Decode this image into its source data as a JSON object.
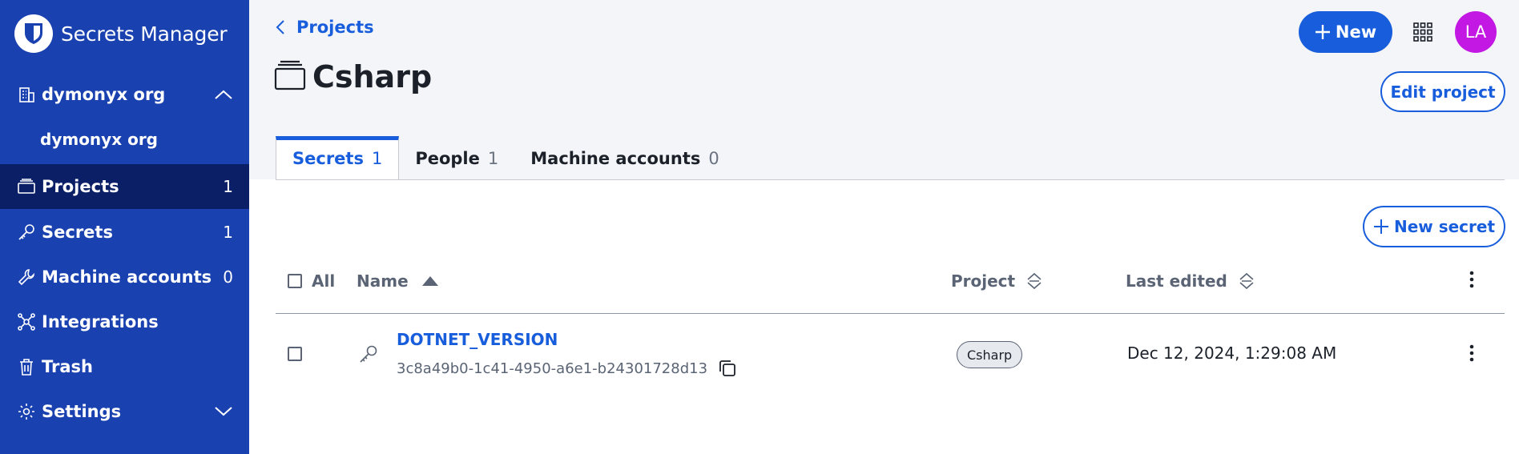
{
  "app": {
    "title": "Secrets Manager"
  },
  "sidebar": {
    "org": {
      "label": "dymonyx org",
      "sub_label": "dymonyx org"
    },
    "items": [
      {
        "label": "Projects",
        "count": "1",
        "icon": "project-icon"
      },
      {
        "label": "Secrets",
        "count": "1",
        "icon": "key-icon"
      },
      {
        "label": "Machine accounts",
        "count": "0",
        "icon": "wrench-icon"
      },
      {
        "label": "Integrations",
        "count": "",
        "icon": "integrations-icon"
      },
      {
        "label": "Trash",
        "count": "",
        "icon": "trash-icon"
      },
      {
        "label": "Settings",
        "count": "",
        "icon": "gear-icon"
      }
    ]
  },
  "header": {
    "breadcrumb": "Projects",
    "page_title": "Csharp",
    "new_label": "New",
    "avatar_initials": "LA",
    "edit_project_label": "Edit project"
  },
  "tabs": [
    {
      "label": "Secrets",
      "count": "1"
    },
    {
      "label": "People",
      "count": "1"
    },
    {
      "label": "Machine accounts",
      "count": "0"
    }
  ],
  "table": {
    "new_secret_label": "New secret",
    "columns": {
      "all": "All",
      "name": "Name",
      "project": "Project",
      "last_edited": "Last edited"
    },
    "rows": [
      {
        "name": "DOTNET_VERSION",
        "id": "3c8a49b0-1c41-4950-a6e1-b24301728d13",
        "project": "Csharp",
        "last_edited": "Dec 12, 2024, 1:29:08 AM"
      }
    ]
  },
  "colors": {
    "sidebar": "#1a41b0",
    "sidebar_active": "#0b1f66",
    "primary": "#175ddc",
    "avatar": "#c318e3",
    "header_bg": "#f3f5f8"
  }
}
